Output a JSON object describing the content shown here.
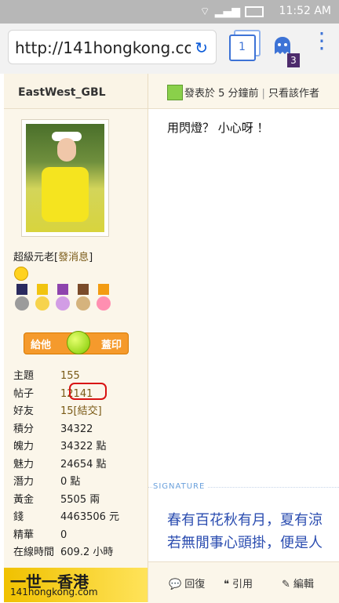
{
  "status": {
    "time": "11:52 AM"
  },
  "browser": {
    "url": "http://141hongkong.com",
    "tab_count": "1",
    "notif_count": "3"
  },
  "user": {
    "name": "EastWest_GBL",
    "rank_prefix": "超級元老",
    "send_msg": "發消息"
  },
  "stamp": {
    "left": "給他",
    "right": "蓋印"
  },
  "stats": [
    {
      "label": "主題",
      "value": "155"
    },
    {
      "label": "帖子",
      "value": "12141"
    },
    {
      "label": "好友",
      "value": "15",
      "link": "[結交]"
    },
    {
      "label": "積分",
      "value": "34322"
    },
    {
      "label": "魄力",
      "value": "34322 點"
    },
    {
      "label": "魅力",
      "value": "24654 點"
    },
    {
      "label": "潛力",
      "value": "0 點"
    },
    {
      "label": "黃金",
      "value": "5505 兩"
    },
    {
      "label": "錢",
      "value": "4463506 元"
    },
    {
      "label": "精華",
      "value": "0"
    },
    {
      "label": "在線時間",
      "value": "609.2 小時"
    }
  ],
  "post": {
    "posted": "發表於 5 分鐘前",
    "owner_only": "只看該作者",
    "text": "用閃燈？ 小心呀 ！"
  },
  "signature": {
    "label": "SIGNATURE",
    "line1": "春有百花秋有月，夏有涼",
    "line2": "若無閒事心頭掛，便是人"
  },
  "actions": {
    "reply": "回復",
    "quote": "引用",
    "edit": "編輯"
  },
  "logo": {
    "line1": "一世一香港",
    "line2": "141hongkong.com"
  }
}
